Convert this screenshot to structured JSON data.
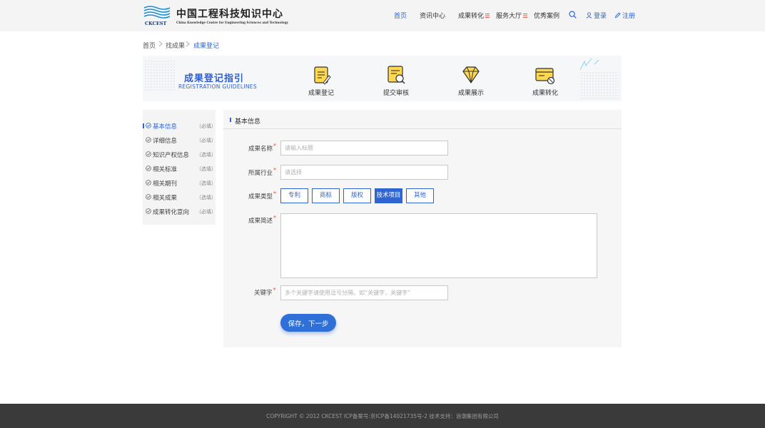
{
  "header": {
    "logo": {
      "name_cn": "中国工程科技知识中心",
      "name_en": "China Knowledge Centre for Engineering Sciences and Technology",
      "abbr": "CKCEST"
    },
    "nav": {
      "home": "首页",
      "news": "资讯中心",
      "achievements": "成果转化",
      "services": "服务大厅",
      "cases": "优秀案例"
    },
    "login": "登录",
    "register": "注册"
  },
  "breadcrumb": {
    "items": [
      "首页",
      "找成果",
      "成果登记"
    ]
  },
  "banner": {
    "title": "成果登记指引",
    "subtitle": "REGISTRATION GUIDELINES",
    "steps": [
      {
        "label": "成果登记",
        "icon": "register-doc-icon"
      },
      {
        "label": "提交审核",
        "icon": "review-search-icon"
      },
      {
        "label": "成果展示",
        "icon": "diamond-icon"
      },
      {
        "label": "成果转化",
        "icon": "transfer-card-icon"
      }
    ]
  },
  "side_menu": {
    "items": [
      {
        "label": "基本信息",
        "tag": "（必填）"
      },
      {
        "label": "详细信息",
        "tag": "（必填）"
      },
      {
        "label": "知识产权信息",
        "tag": "（选填）"
      },
      {
        "label": "相关标准",
        "tag": "（选填）"
      },
      {
        "label": "相关期刊",
        "tag": "（选填）"
      },
      {
        "label": "相关成果",
        "tag": "（选填）"
      },
      {
        "label": "成果转化意向",
        "tag": "（必填）"
      }
    ]
  },
  "form": {
    "section_title": "基本信息",
    "required_mark": "*",
    "name": {
      "label": "成果名称",
      "placeholder": "请输入标题"
    },
    "industry": {
      "label": "所属行业",
      "placeholder": "请选择"
    },
    "type": {
      "label": "成果类型",
      "options": [
        "专利",
        "商标",
        "版权",
        "技术项目",
        "其他"
      ],
      "selected": "技术项目"
    },
    "summary": {
      "label": "成果简述"
    },
    "keywords": {
      "label": "关键字",
      "placeholder": "多个关键字请使用逗号分隔，如“关键字，关键字”"
    },
    "save_label": "保存，下一步"
  },
  "footer": {
    "text": "COPYRIGHT © 2012 CKCEST ICP备案号:京ICP备14021735号-2  技术支持：浪潮集团有限公司"
  },
  "colors": {
    "accent": "#2f65d2",
    "required": "#e84c3d",
    "footer_bg": "#3a3a3a"
  }
}
